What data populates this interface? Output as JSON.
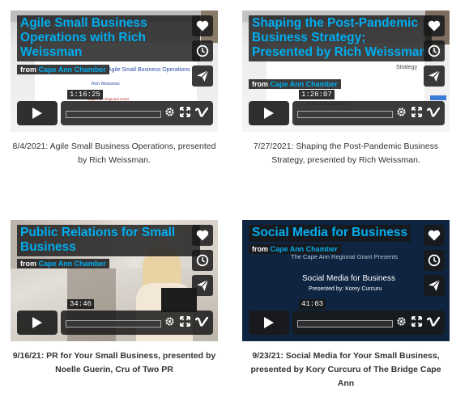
{
  "colors": {
    "accent": "#00adef",
    "panel": "#191919",
    "text": "#333333"
  },
  "videos": [
    {
      "title": "Agile Small Business Operations with Rich Weissman",
      "from_label": "from",
      "owner": "Cape Ann Chamber",
      "duration": "1:16:25",
      "caption": "8/4/2021: Agile Small Business Operations, presented by Rich Weissman.",
      "thumb_text": [
        "Agile Small Business Operations",
        "Rich Weissman",
        "Cape Ann Regional Grant"
      ]
    },
    {
      "title": "Shaping the Post-Pandemic Business Strategy; Presented by Rich Weissman",
      "from_label": "from",
      "owner": "Cape Ann Chamber",
      "duration": "1:26:07",
      "caption": "7/27/2021: Shaping the Post-Pandemic Business Strategy, presented by Rich Weissman.",
      "thumb_text": [
        "Strategy",
        "Cape Ann Regional Grant"
      ]
    },
    {
      "title": "Public Relations for Small Business",
      "from_label": "from",
      "owner": "Cape Ann Chamber",
      "duration": "34:46",
      "caption": "9/16/21: PR for Your Small Business, presented by Noelle Guerin, Cru of Two PR",
      "thumb_text": []
    },
    {
      "title": "Social Media for Business",
      "from_label": "from",
      "owner": "Cape Ann Chamber",
      "duration": "41:03",
      "caption": "9/23/21: Social Media for Your Small Business, presented by Kory Curcuru of The Bridge Cape Ann",
      "thumb_text": [
        "The Cape Ann Regional Grant Presents",
        "Social Media for Business",
        "Presented by: Korey Curcuru"
      ]
    }
  ],
  "icons": [
    "heart-icon",
    "clock-icon",
    "paper-plane-icon",
    "play-icon",
    "settings-icon",
    "fullscreen-icon",
    "vimeo-icon"
  ]
}
